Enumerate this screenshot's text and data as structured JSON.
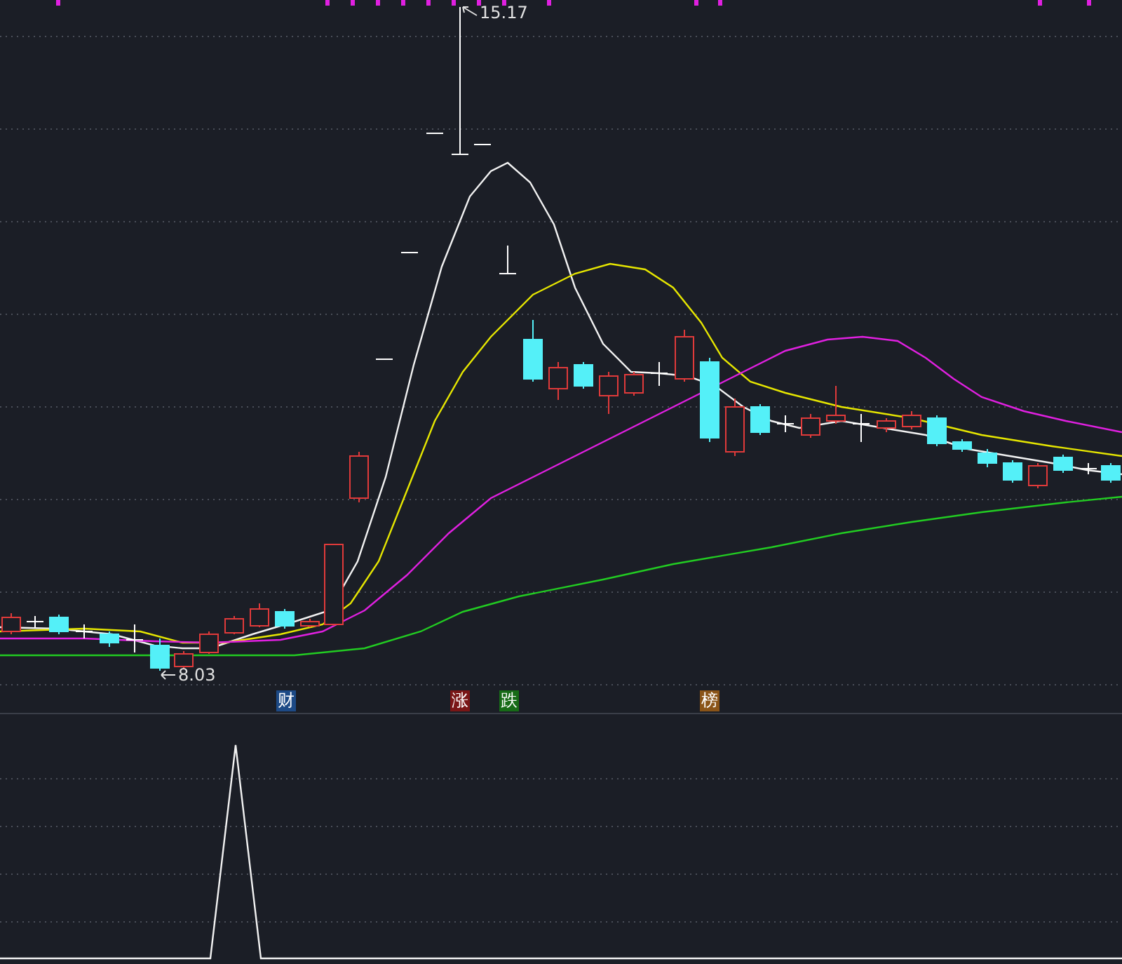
{
  "price_chart": {
    "high_marker": "15.17",
    "low_marker": "8.03",
    "event_badges": [
      {
        "label": "财",
        "color": "#1d4a86"
      },
      {
        "label": "涨",
        "color": "#7a1616"
      },
      {
        "label": "跌",
        "color": "#176b17"
      },
      {
        "label": "榜",
        "color": "#8a5418"
      }
    ]
  }
}
